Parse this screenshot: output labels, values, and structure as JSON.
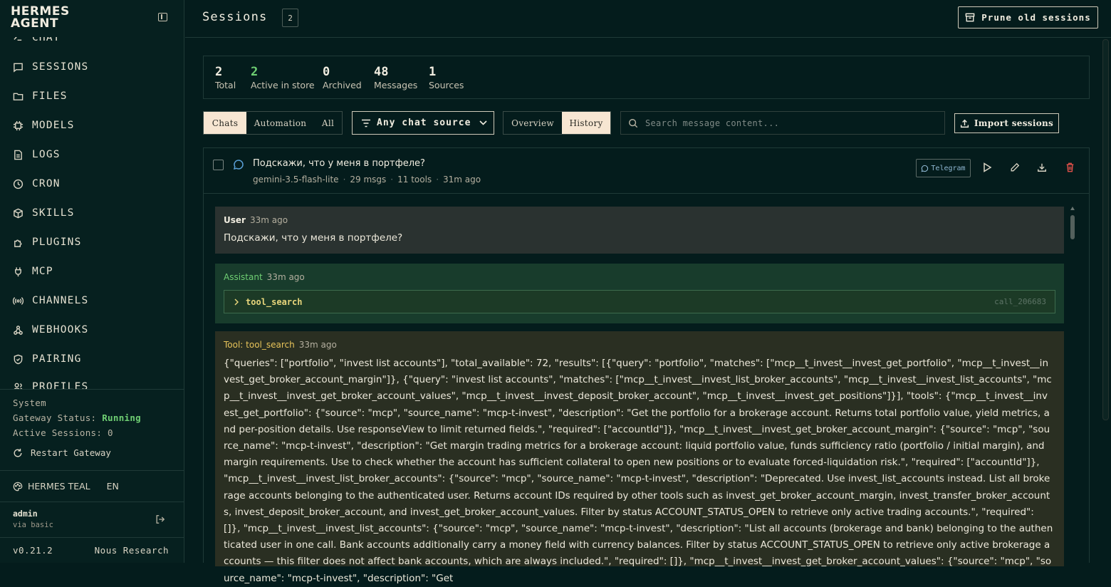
{
  "brand": {
    "line1": "HERMES",
    "line2": "AGENT"
  },
  "nav": {
    "items": [
      {
        "label": "CHAT",
        "icon": "chat-icon"
      },
      {
        "label": "SESSIONS",
        "icon": "message-square-icon"
      },
      {
        "label": "FILES",
        "icon": "folder-icon"
      },
      {
        "label": "MODELS",
        "icon": "cpu-icon"
      },
      {
        "label": "LOGS",
        "icon": "file-text-icon"
      },
      {
        "label": "CRON",
        "icon": "clock-icon"
      },
      {
        "label": "SKILLS",
        "icon": "package-icon"
      },
      {
        "label": "PLUGINS",
        "icon": "puzzle-icon"
      },
      {
        "label": "MCP",
        "icon": "plug-icon"
      },
      {
        "label": "CHANNELS",
        "icon": "radio-icon"
      },
      {
        "label": "WEBHOOKS",
        "icon": "webhook-icon"
      },
      {
        "label": "PAIRING",
        "icon": "shield-icon"
      },
      {
        "label": "PROFILES",
        "icon": "users-icon"
      }
    ]
  },
  "system": {
    "heading": "System",
    "gateway_label": "Gateway Status:",
    "gateway_status": "Running",
    "active_sessions": "Active Sessions: 0",
    "restart_label": "Restart Gateway"
  },
  "theme": {
    "name": "HERMES TEAL",
    "lang": "EN"
  },
  "user": {
    "name": "admin",
    "auth": "via basic"
  },
  "footer": {
    "version": "v0.21.2",
    "vendor": "Nous Research"
  },
  "header": {
    "title": "Sessions",
    "count": "2",
    "prune_label": "Prune old sessions"
  },
  "stats": [
    {
      "value": "2",
      "label": "Total"
    },
    {
      "value": "2",
      "label": "Active in store"
    },
    {
      "value": "0",
      "label": "Archived"
    },
    {
      "value": "48",
      "label": "Messages"
    },
    {
      "value": "1",
      "label": "Sources"
    }
  ],
  "filters": {
    "kind_tabs": [
      "Chats",
      "Automation",
      "All"
    ],
    "kind_selected": "Chats",
    "source_dropdown": "Any chat source",
    "view_tabs": [
      "Overview",
      "History"
    ],
    "view_selected": "History",
    "search_placeholder": "Search message content...",
    "import_label": "Import sessions"
  },
  "session": {
    "title": "Подскажи, что у меня в портфеле?",
    "model": "gemini-3.5-flash-lite",
    "msgs": "29 msgs",
    "tools": "11 tools",
    "age": "31m ago",
    "source_badge": "Telegram"
  },
  "messages": {
    "user": {
      "role": "User",
      "time": "33m ago",
      "text": "Подскажи, что у меня в портфеле?"
    },
    "assistant": {
      "role": "Assistant",
      "time": "33m ago",
      "tool_name": "tool_search",
      "call_id": "call_206683"
    },
    "tool": {
      "role": "Tool: tool_search",
      "time": "33m ago",
      "text": "{\"queries\": [\"portfolio\", \"invest list accounts\"], \"total_available\": 72, \"results\": [{\"query\": \"portfolio\", \"matches\": [\"mcp__t_invest__invest_get_portfolio\", \"mcp__t_invest__invest_get_broker_account_margin\"]}, {\"query\": \"invest list accounts\", \"matches\": [\"mcp__t_invest__invest_list_broker_accounts\", \"mcp__t_invest__invest_list_accounts\", \"mcp__t_invest__invest_get_broker_account_values\", \"mcp__t_invest__invest_deposit_broker_account\", \"mcp__t_invest__invest_get_positions\"]}], \"tools\": {\"mcp__t_invest__invest_get_portfolio\": {\"source\": \"mcp\", \"source_name\": \"mcp-t-invest\", \"description\": \"Get the portfolio for a brokerage account. Returns total portfolio value, yield metrics, and per-position details. Use responseView to limit returned fields.\", \"required\": [\"accountId\"]}, \"mcp__t_invest__invest_get_broker_account_margin\": {\"source\": \"mcp\", \"source_name\": \"mcp-t-invest\", \"description\": \"Get margin trading metrics for a brokerage account: liquid portfolio value, funds sufficiency ratio (portfolio / initial margin), and margin requirements. Use to check whether the account has sufficient collateral to open new positions or to evaluate forced-liquidation risk.\", \"required\": [\"accountId\"]}, \"mcp__t_invest__invest_list_broker_accounts\": {\"source\": \"mcp\", \"source_name\": \"mcp-t-invest\", \"description\": \"Deprecated. Use invest_list_accounts instead. List all brokerage accounts belonging to the authenticated user. Returns account IDs required by other tools such as invest_get_broker_account_margin, invest_transfer_broker_accounts, invest_deposit_broker_account, and invest_get_broker_account_values. Filter by status ACCOUNT_STATUS_OPEN to retrieve only active trading accounts.\", \"required\": []}, \"mcp__t_invest__invest_list_accounts\": {\"source\": \"mcp\", \"source_name\": \"mcp-t-invest\", \"description\": \"List all accounts (brokerage and bank) belonging to the authenticated user in one call. Bank accounts additionally carry a money field with currency balances. Filter by status ACCOUNT_STATUS_OPEN to retrieve only active brokerage accounts — this filter does not affect bank accounts, which are always included.\", \"required\": []}, \"mcp__t_invest__invest_get_broker_account_values\": {\"source\": \"mcp\", \"source_name\": \"mcp-t-invest\", \"description\": \"Get"
    }
  },
  "colors": {
    "background": "#041c1c",
    "accent_active": "#f7e6d2",
    "running": "#6fcf73",
    "stat_highlight": "#6fcf73",
    "user_role": "#f1ede0",
    "assistant_role": "#6fcf73",
    "tool_role": "#e8c45a",
    "delete": "#e0504a"
  }
}
